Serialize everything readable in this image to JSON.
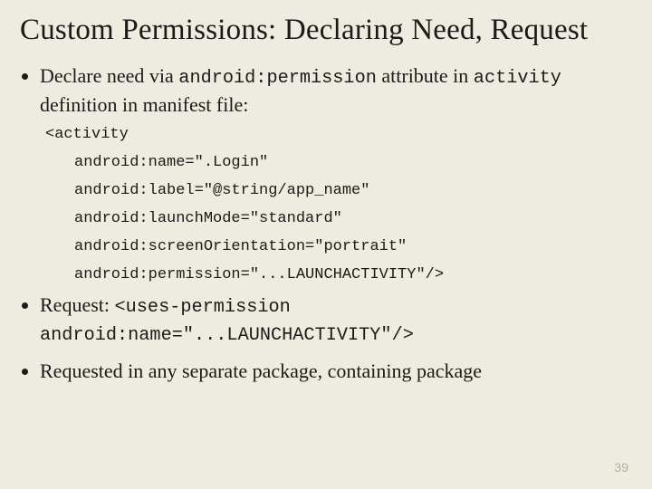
{
  "title": "Custom Permissions: Declaring Need, Request",
  "bullets": {
    "b1_pre": "Declare need via ",
    "b1_code1": "android:permission",
    "b1_mid": " attribute in ",
    "b1_code2": "activity",
    "b1_post": " definition in manifest file:",
    "b2_pre": "Request: ",
    "b2_code": "<uses-permission android:name=\"...LAUNCHACTIVITY\"/>",
    "b3": "Requested in any separate package, containing package"
  },
  "code": {
    "l0": "<activity",
    "l1": "android:name=\".Login\"",
    "l2": "android:label=\"@string/app_name\"",
    "l3": "android:launchMode=\"standard\"",
    "l4": "android:screenOrientation=\"portrait\"",
    "l5": "android:permission=\"...LAUNCHACTIVITY\"/>"
  },
  "page_number": "39"
}
